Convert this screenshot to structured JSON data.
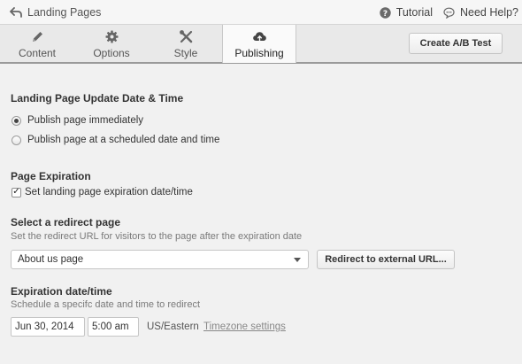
{
  "topbar": {
    "back_label": "Landing Pages",
    "tutorial_label": "Tutorial",
    "help_label": "Need Help?"
  },
  "tabs": [
    {
      "label": "Content",
      "icon": "pencil-icon",
      "active": false
    },
    {
      "label": "Options",
      "icon": "gear-icon",
      "active": false
    },
    {
      "label": "Style",
      "icon": "tools-icon",
      "active": false
    },
    {
      "label": "Publishing",
      "icon": "cloud-upload-icon",
      "active": true
    }
  ],
  "ab_test_button": "Create A/B Test",
  "update_section": {
    "heading": "Landing Page Update Date & Time",
    "options": [
      {
        "label": "Publish page immediately",
        "selected": true
      },
      {
        "label": "Publish page at a scheduled date and time",
        "selected": false
      }
    ]
  },
  "expiration_section": {
    "heading": "Page Expiration",
    "checkbox_label": "Set landing page expiration date/time",
    "checked": true
  },
  "redirect_section": {
    "heading": "Select a redirect page",
    "description": "Set the redirect URL for visitors to the page after the expiration date",
    "selected_page": "About us page",
    "external_button": "Redirect to external URL..."
  },
  "date_section": {
    "heading": "Expiration date/time",
    "description": "Schedule a specifc date and time to redirect",
    "date_value": "Jun 30, 2014",
    "time_value": "5:00 am",
    "timezone": "US/Eastern",
    "timezone_link": "Timezone settings"
  }
}
